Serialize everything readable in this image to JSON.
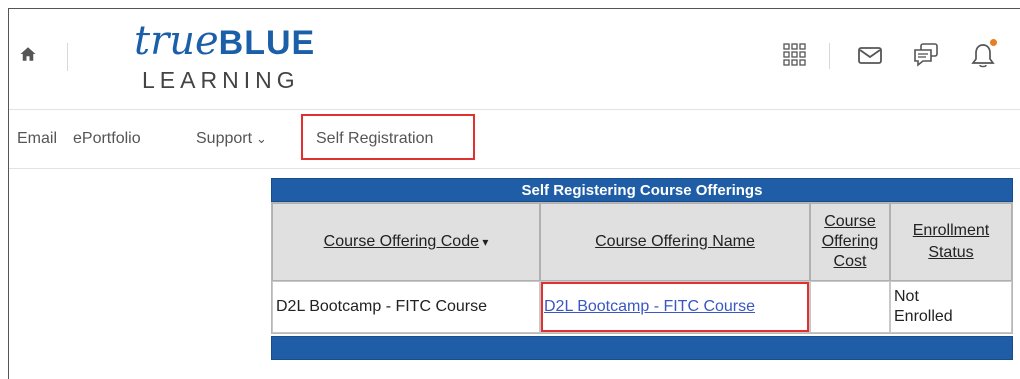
{
  "header": {
    "logo_top_italic": "true",
    "logo_top_bold": "BLUE",
    "logo_bottom": "LEARNING"
  },
  "icons": [
    "home-icon",
    "waffle-grid-icon",
    "mail-icon",
    "chat-icon",
    "bell-icon"
  ],
  "colors": {
    "brand_blue": "#1f5ea6",
    "highlight_red": "#e03030",
    "link_blue": "#3a57c4",
    "notification_dot": "#e67e22"
  },
  "nav": {
    "items": [
      {
        "label": "Email"
      },
      {
        "label": "ePortfolio"
      },
      {
        "label": "Support"
      },
      {
        "label": "Self Registration"
      }
    ]
  },
  "table": {
    "caption": "Self Registering Course Offerings",
    "headers": {
      "code": "Course Offering Code",
      "name": "Course Offering Name",
      "cost_line1": "Course",
      "cost_line2": "Offering",
      "cost_line3": "Cost",
      "status_line1": "Enrollment",
      "status_line2": "Status"
    },
    "rows": [
      {
        "code": "D2L Bootcamp - FITC Course",
        "name": "D2L Bootcamp - FITC Course",
        "cost": "",
        "status_line1": "Not",
        "status_line2": "Enrolled"
      }
    ]
  }
}
